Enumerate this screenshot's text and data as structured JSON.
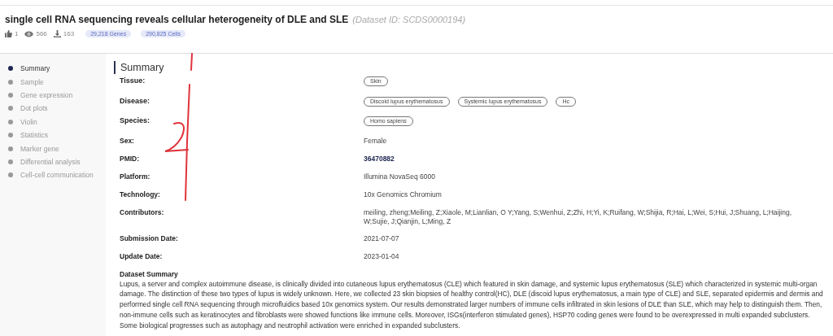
{
  "header": {
    "title": "single cell RNA sequencing reveals cellular heterogeneity of DLE and SLE",
    "dataset_id": "(Dataset ID: SCDS0000194)",
    "stats": [
      {
        "kind": "likes",
        "value": "1"
      },
      {
        "kind": "views",
        "value": "566"
      },
      {
        "kind": "downloads",
        "value": "163"
      }
    ],
    "badges": [
      "29,218 Genes",
      "290,825 Cells"
    ]
  },
  "sidebar": {
    "items": [
      {
        "label": "Summary",
        "selected": true
      },
      {
        "label": "Sample",
        "selected": false
      },
      {
        "label": "Gene expression",
        "selected": false
      },
      {
        "label": "Dot plots",
        "selected": false
      },
      {
        "label": "Violin",
        "selected": false
      },
      {
        "label": "Statistics",
        "selected": false
      },
      {
        "label": "Marker gene",
        "selected": false
      },
      {
        "label": "Differential analysis",
        "selected": false
      },
      {
        "label": "Cell-cell communication",
        "selected": false
      }
    ]
  },
  "summary": {
    "heading": "Summary",
    "fields": [
      {
        "label": "Tissue:",
        "kind": "tags",
        "tags": [
          "Skin"
        ]
      },
      {
        "label": "Disease:",
        "kind": "tags",
        "tags": [
          "Discoid lupus erythematosus",
          "Systemic lupus erythematosus",
          "Hc"
        ]
      },
      {
        "label": "Species:",
        "kind": "tags",
        "tags": [
          "Homo sapiens"
        ]
      },
      {
        "label": "Sex:",
        "kind": "text",
        "value": "Female"
      },
      {
        "label": "PMID:",
        "kind": "link",
        "value": "36470882"
      },
      {
        "label": "Platform:",
        "kind": "text",
        "value": "Illumina NovaSeq 6000"
      },
      {
        "label": "Technology:",
        "kind": "text",
        "value": "10x Genomics Chromium"
      },
      {
        "label": "Contributors:",
        "kind": "text",
        "value": "meiling, zheng;Meiling, Z;Xiaole, M;Lianlian, O Y;Yang, S;Wenhui, Z;Zhi, H;Yi, K;Ruifang, W;Shijia, R;Hai, L;Wei, S;Hui, J;Shuang, L;Haijing, W;Sujie, J;Qianjin, L;Ming, Z"
      },
      {
        "label": "Submission Date:",
        "kind": "text",
        "value": "2021-07-07"
      },
      {
        "label": "Update Date:",
        "kind": "text",
        "value": "2023-01-04"
      }
    ],
    "dataset_summary_heading": "Dataset Summary",
    "dataset_summary": "Lupus, a server and complex autoimmune disease, is clinically divided into cutaneous lupus erythematosus (CLE) which featured in skin damage, and systemic lupus erythematosus (SLE) which characterized in systemic multi-organ damage. The distinction of these two types of lupus is widely unknown. Here, we collected 23 skin biopsies of healthy control(HC), DLE (discoid lupus erythematosus, a main type of CLE) and SLE, separated epidermis and dermis and performed single cell RNA sequencing through microfluidics based 10x genomics system. Our results demonstrated larger numbers of immune cells infiltrated in skin lesions of DLE than SLE, which may help to distinguish them. Then, non-immune cells such as keratinocytes and fibroblasts were showed functions like immune cells. Moreover, ISGs(interferon stimulated genes), HSP70 coding genes were found to be overexpressed in multi expanded subclusters. Some biological progresses such as autophagy and neutrophil activation were enriched in expanded subclusters."
  }
}
